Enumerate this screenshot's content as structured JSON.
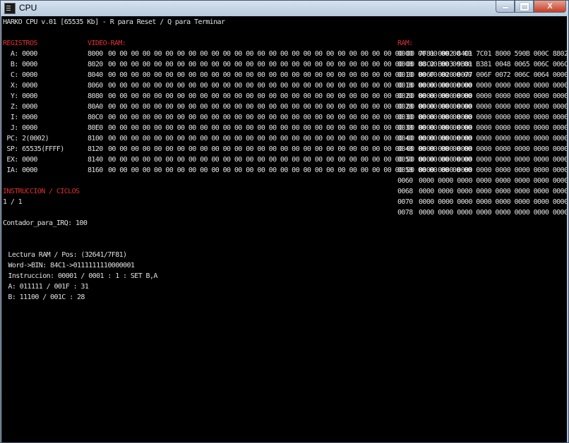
{
  "window": {
    "title": "CPU",
    "minimize": "minimize",
    "maximize": "maximize",
    "close": "X"
  },
  "header": "HARKO CPU v.01 [65535 Kb] - R para Reset / Q para Terminar",
  "registers": {
    "title": "REGISTROS",
    "items": [
      "  A: 0000",
      "  B: 0000",
      "  C: 0000",
      "  X: 0000",
      "  Y: 0000",
      "  Z: 0000",
      "  I: 0000",
      "  J: 0000",
      " PC: 2(0002)",
      " SP: 65535(FFFF)",
      " EX: 0000",
      " IA: 0000"
    ]
  },
  "video_ram": {
    "title": "VIDEO-RAM:",
    "rows": [
      {
        "addr": "8000",
        "data": "00 00 00 00 00 00 00 00 00 00 00 00 00 00 00 00 00 00 00 00 00 00 00 00 00 00 00 00 00 00 00 00"
      },
      {
        "addr": "8020",
        "data": "00 00 00 00 00 00 00 00 00 00 00 00 00 00 00 00 00 00 00 00 00 00 00 00 00 00 00 00 00 00 00 00"
      },
      {
        "addr": "8040",
        "data": "00 00 00 00 00 00 00 00 00 00 00 00 00 00 00 00 00 00 00 00 00 00 00 00 00 00 00 00 00 00 00 00"
      },
      {
        "addr": "8060",
        "data": "00 00 00 00 00 00 00 00 00 00 00 00 00 00 00 00 00 00 00 00 00 00 00 00 00 00 00 00 00 00 00 00"
      },
      {
        "addr": "8080",
        "data": "00 00 00 00 00 00 00 00 00 00 00 00 00 00 00 00 00 00 00 00 00 00 00 00 00 00 00 00 00 00 00 00"
      },
      {
        "addr": "80A0",
        "data": "00 00 00 00 00 00 00 00 00 00 00 00 00 00 00 00 00 00 00 00 00 00 00 00 00 00 00 00 00 00 00 00"
      },
      {
        "addr": "80C0",
        "data": "00 00 00 00 00 00 00 00 00 00 00 00 00 00 00 00 00 00 00 00 00 00 00 00 00 00 00 00 00 00 00 00"
      },
      {
        "addr": "80E0",
        "data": "00 00 00 00 00 00 00 00 00 00 00 00 00 00 00 00 00 00 00 00 00 00 00 00 00 00 00 00 00 00 00 00"
      },
      {
        "addr": "8100",
        "data": "00 00 00 00 00 00 00 00 00 00 00 00 00 00 00 00 00 00 00 00 00 00 00 00 00 00 00 00 00 00 00 00"
      },
      {
        "addr": "8120",
        "data": "00 00 00 00 00 00 00 00 00 00 00 00 00 00 00 00 00 00 00 00 00 00 00 00 00 00 00 00 00 00 00 00"
      },
      {
        "addr": "8140",
        "data": "00 00 00 00 00 00 00 00 00 00 00 00 00 00 00 00 00 00 00 00 00 00 00 00 00 00 00 00 00 00 00 00"
      },
      {
        "addr": "8160",
        "data": "00 00 00 00 00 00 00 00 00 00 00 00 00 00 00 00 00 00 00 00 00 00 00 00 00 00 00 00 00 00 00 00"
      }
    ]
  },
  "ram": {
    "title": "RAM:",
    "rows": [
      {
        "addr": "0000",
        "data": "7F81 0002 84C1 7C01 8000 590B 000C 8802"
      },
      {
        "addr": "0008",
        "data": "88C2 B0D3 9B81 B381 0048 0065 006C 006C"
      },
      {
        "addr": "0010",
        "data": "006F 0020 0077 006F 0072 006C 0064 0000"
      },
      {
        "addr": "0018",
        "data": "0000 0000 0000 0000 0000 0000 0000 0000"
      },
      {
        "addr": "0020",
        "data": "0000 0000 0000 0000 0000 0000 0000 0000"
      },
      {
        "addr": "0028",
        "data": "0000 0000 0000 0000 0000 0000 0000 0000"
      },
      {
        "addr": "0030",
        "data": "0000 0000 0000 0000 0000 0000 0000 0000"
      },
      {
        "addr": "0038",
        "data": "0000 0000 0000 0000 0000 0000 0000 0000"
      },
      {
        "addr": "0040",
        "data": "0000 0000 0000 0000 0000 0000 0000 0000"
      },
      {
        "addr": "0048",
        "data": "0000 0000 0000 0000 0000 0000 0000 0000"
      },
      {
        "addr": "0050",
        "data": "0000 0000 0000 0000 0000 0000 0000 0000"
      },
      {
        "addr": "0058",
        "data": "0000 0000 0000 0000 0000 0000 0000 0000"
      },
      {
        "addr": "0060",
        "data": "0000 0000 0000 0000 0000 0000 0000 0000"
      },
      {
        "addr": "0068",
        "data": "0000 0000 0000 0000 0000 0000 0000 0000"
      },
      {
        "addr": "0070",
        "data": "0000 0000 0000 0000 0000 0000 0000 0000"
      },
      {
        "addr": "0078",
        "data": "0000 0000 0000 0000 0000 0000 0000 0000"
      }
    ]
  },
  "instruction": {
    "title": "INSTRUCCION / CICLOS",
    "value": "1 / 1"
  },
  "irq_counter": "Contador_para_IRQ: 100",
  "debug": [
    " Lectura RAM / Pos: (32641/7F81)",
    " Word->BIN: 84C1->0111111110000001",
    " Instruccion: 00001 / 0001 : 1 : SET B,A",
    " A: 011111 / 001F : 31",
    " B: 11100 / 001C : 28"
  ],
  "colors": {
    "background": "#000000",
    "text": "#e0e0e0",
    "heading": "#e03030"
  }
}
